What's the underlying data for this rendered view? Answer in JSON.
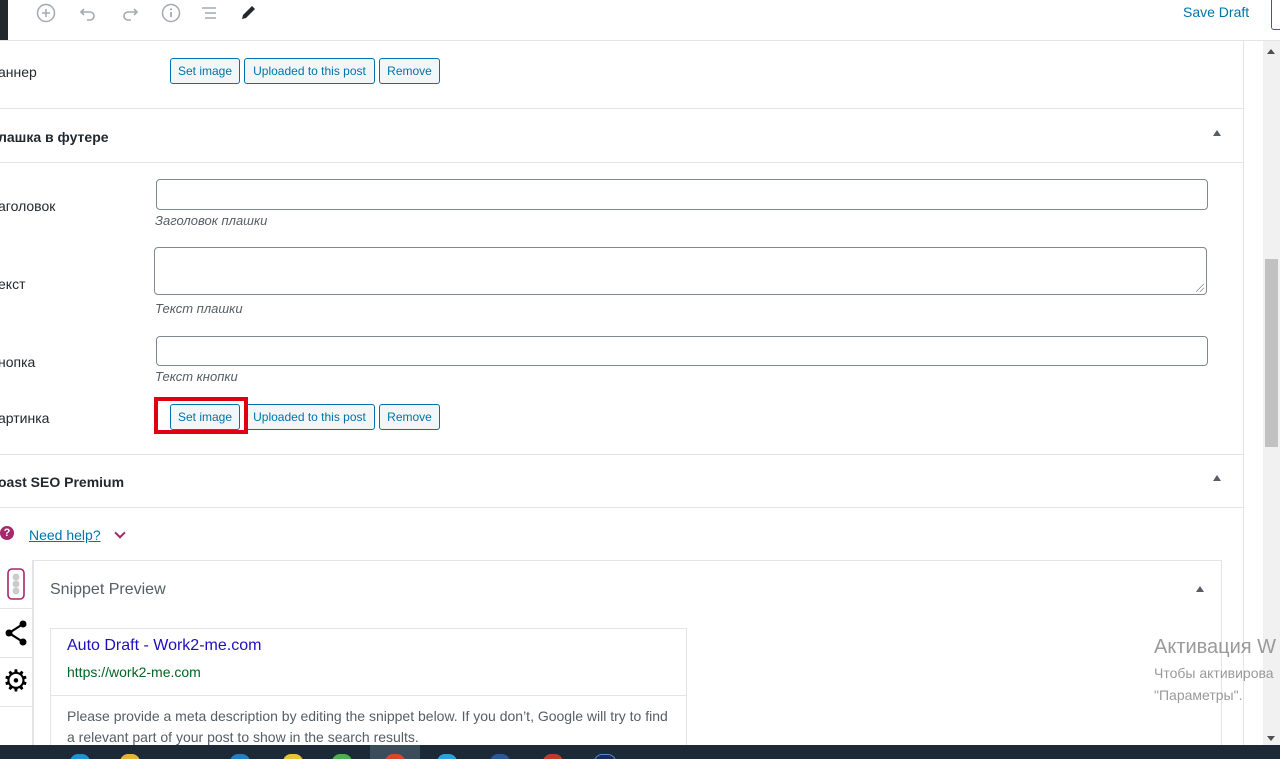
{
  "toolbar": {
    "icons": [
      "add-block-icon",
      "undo-icon",
      "redo-icon",
      "info-icon",
      "outline-icon",
      "edit-tools-icon"
    ],
    "save_draft": "Save Draft"
  },
  "banner": {
    "label": "аннер",
    "buttons": {
      "set_image": "Set image",
      "uploaded": "Uploaded to this post",
      "remove": "Remove"
    }
  },
  "footer_plate": {
    "title": "лашка в футере",
    "heading": {
      "label": "аголовок",
      "value": "",
      "hint": "Заголовок плашки"
    },
    "text": {
      "label": "екст",
      "value": "",
      "hint": "Текст плашки"
    },
    "button": {
      "label": "нопка",
      "value": "",
      "hint": "Текст кнопки"
    },
    "image": {
      "label": "артинка",
      "buttons": {
        "set_image": "Set image",
        "uploaded": "Uploaded to this post",
        "remove": "Remove"
      }
    }
  },
  "yoast": {
    "title": "oast SEO Premium",
    "help_icon": "?",
    "need_help": "Need help?",
    "side_tabs": [
      "traffic-light-icon",
      "share-icon",
      "gear-icon"
    ],
    "snippet": {
      "title": "Snippet Preview",
      "serp_title_site": "Auto Draft",
      "serp_title_sep": " - ",
      "serp_title_brand": "Work2-me.com",
      "url": "https://work2-me.com",
      "description": "Please provide a meta description by editing the snippet below. If you don’t, Google will try to find a relevant part of your post to show in the search results."
    }
  },
  "watermark": {
    "line1": "Активация W",
    "line2": "Чтобы активирова",
    "line3": "\"Параметры\"."
  },
  "colors": {
    "accent": "#0073aa",
    "highlight": "#e00012",
    "yoast": "#a4286a",
    "serp_title": "#1e0fbe",
    "serp_url": "#006621"
  }
}
